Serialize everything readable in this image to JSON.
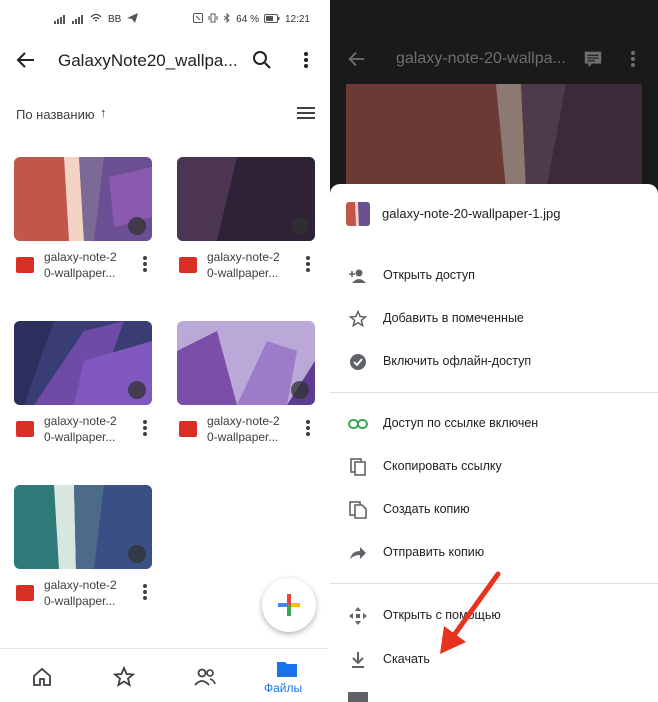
{
  "left": {
    "status": {
      "carrier": "BB",
      "battery": "64 %",
      "time": "12:21"
    },
    "appbar": {
      "title": "GalaxyNote20_wallpa...",
      "back_icon": "arrow-left-icon",
      "search_icon": "search-icon",
      "more_icon": "more-vert-icon"
    },
    "sort": {
      "label": "По названию",
      "arrow": "↑",
      "view_icon": "list-view-icon"
    },
    "files": [
      {
        "name": "galaxy-note-2\n0-wallpaper..."
      },
      {
        "name": "galaxy-note-2\n0-wallpaper..."
      },
      {
        "name": "galaxy-note-2\n0-wallpaper..."
      },
      {
        "name": "galaxy-note-2\n0-wallpaper..."
      },
      {
        "name": "galaxy-note-2\n0-wallpaper..."
      }
    ],
    "nav": {
      "files_label": "Файлы"
    }
  },
  "right": {
    "appbar": {
      "title": "galaxy-note-20-wallpa..."
    },
    "sheet": {
      "filename": "galaxy-note-20-wallpaper-1.jpg",
      "items": [
        {
          "label": "Открыть доступ",
          "icon": "person-add-icon"
        },
        {
          "label": "Добавить в помеченные",
          "icon": "star-outline-icon"
        },
        {
          "label": "Включить офлайн-доступ",
          "icon": "offline-check-icon"
        },
        {
          "label": "Доступ по ссылке включен",
          "icon": "link-icon"
        },
        {
          "label": "Скопировать ссылку",
          "icon": "copy-icon"
        },
        {
          "label": "Создать копию",
          "icon": "file-copy-icon"
        },
        {
          "label": "Отправить копию",
          "icon": "share-arrow-icon"
        },
        {
          "label": "Открыть с помощью",
          "icon": "open-with-icon"
        },
        {
          "label": "Скачать",
          "icon": "download-icon"
        }
      ]
    }
  },
  "colors": {
    "accent": "#1a73e8",
    "file_image_icon": "#d93025",
    "annotation_arrow": "#e8321c"
  }
}
